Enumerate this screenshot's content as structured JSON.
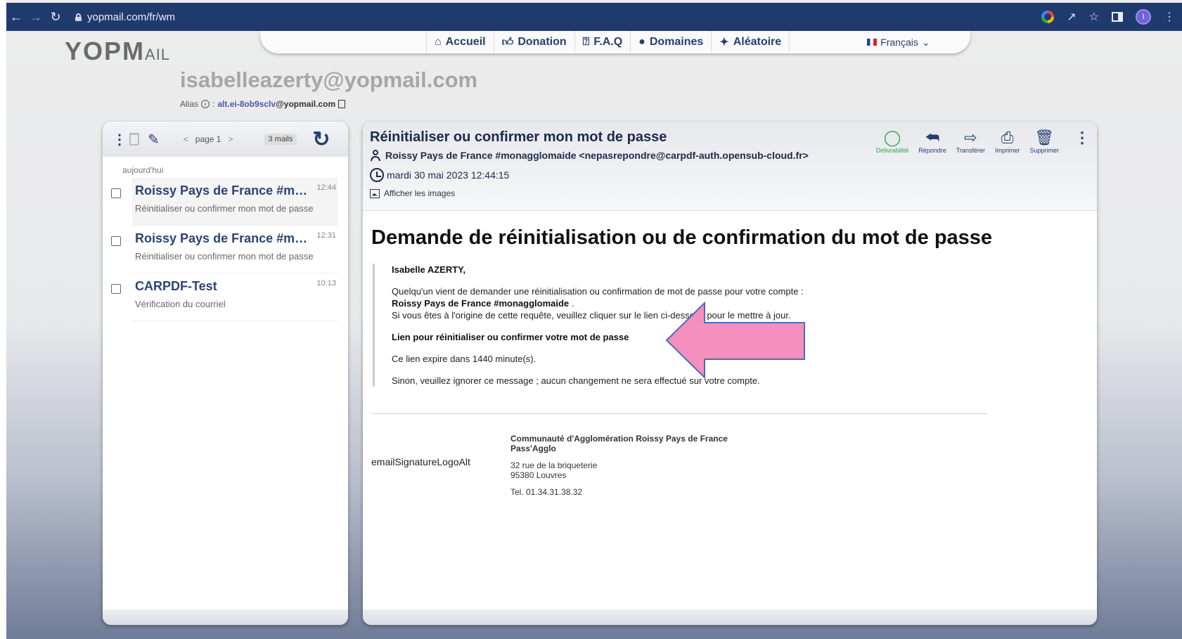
{
  "browser": {
    "url": "yopmail.com/fr/wm",
    "avatar_letter": "I"
  },
  "header": {
    "logo_main": "YOPM",
    "logo_tail": "AIL",
    "nav": [
      {
        "label": "Accueil",
        "icon": "home-icon"
      },
      {
        "label": "Donation",
        "icon": "thumbs-up-icon"
      },
      {
        "label": "F.A.Q",
        "icon": "question-icon"
      },
      {
        "label": "Domaines",
        "icon": "globe-icon"
      },
      {
        "label": "Aléatoire",
        "icon": "magic-wand-icon"
      }
    ],
    "language": "Français",
    "mailbox": "isabelleazerty@yopmail.com",
    "alias_label": "Alias",
    "alias_user": "alt.ei-8ob9sclv",
    "alias_domain": "@yopmail.com"
  },
  "inbox": {
    "page": "page 1",
    "count": "3 mails",
    "day_label": "aujourd'hui",
    "mails": [
      {
        "from": "Roissy Pays de France #monagglomaide",
        "time": "12:44",
        "subject": "Réinitialiser ou confirmer mon mot de passe"
      },
      {
        "from": "Roissy Pays de France #monagglomaide",
        "time": "12:31",
        "subject": "Réinitialiser ou confirmer mon mot de passe"
      },
      {
        "from": "CARPDF-Test",
        "time": "10:13",
        "subject": "Vérification du courriel"
      }
    ]
  },
  "message": {
    "subject": "Réinitialiser ou confirmer mon mot de passe",
    "from": "Roissy Pays de France #monagglomaide <nepasrepondre@carpdf-auth.opensub-cloud.fr>",
    "date": "mardi 30 mai 2023 12:44:15",
    "show_images": "Afficher les images",
    "actions": {
      "deliverability": "Délivrabilité",
      "reply": "Répondre",
      "forward": "Transférer",
      "print": "Imprimer",
      "delete": "Supprimer"
    },
    "body": {
      "heading": "Demande de réinitialisation ou de confirmation du mot de passe",
      "greeting": "Isabelle AZERTY,",
      "line1": "Quelqu'un vient de demander une réinitialisation ou confirmation de mot de passe pour votre compte :",
      "account": "Roissy Pays de France #monagglomaide",
      "account_suffix": ".",
      "line2": "Si vous êtes à l'origine de cette requête, veuillez cliquer sur le lien ci-dessous pour le mettre à jour.",
      "link": "Lien pour réinitialiser ou confirmer votre mot de passe",
      "expiry": "Ce lien expire dans 1440 minute(s).",
      "otherwise": "Sinon, veuillez ignorer ce message ; aucun changement ne sera effectué sur votre compte."
    },
    "signature": {
      "logo_alt": "emailSignatureLogoAlt",
      "org": "Communauté d'Agglomération Roissy Pays de France",
      "org2": "Pass'Agglo",
      "address1": "32 rue de la briqueterie",
      "address2": "95380 Louvres",
      "tel": "Tel. 01.34.31.38.32"
    }
  },
  "colors": {
    "browser_bar": "#1f3b6d",
    "accent_navy": "#263f6e",
    "deliverability_green": "#2aa84a",
    "arrow_pink": "#f58fbd"
  }
}
